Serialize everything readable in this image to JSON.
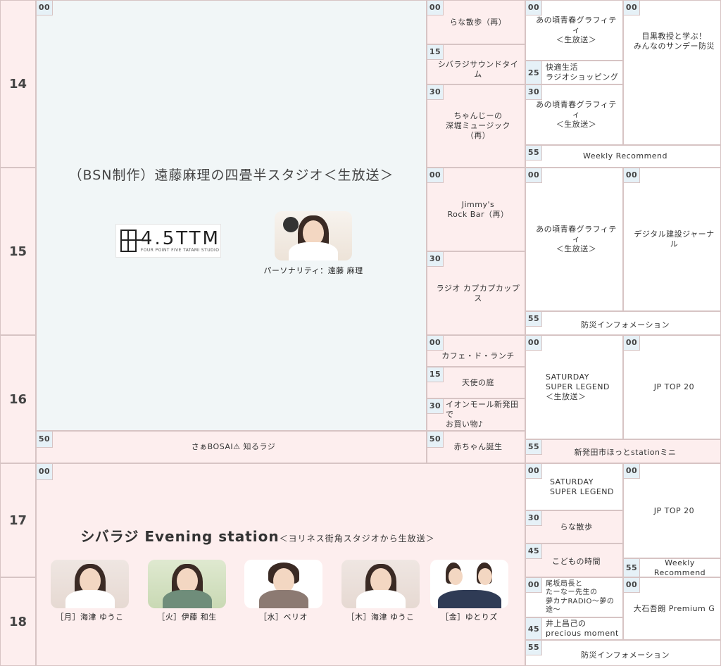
{
  "hours": [
    "14",
    "15",
    "16",
    "17",
    "18"
  ],
  "slots": [
    {
      "name": "slot-4-5ttm",
      "time": "00",
      "title": "",
      "bg": "blue"
    },
    {
      "name": "slot-saa-bosai",
      "time": "50",
      "title": "さぁBOSAI⚠ 知るラジ",
      "bg": "pink"
    },
    {
      "name": "slot-evening-station",
      "time": "00",
      "title": "",
      "bg": "pink"
    },
    {
      "name": "slot-rana-sanpo-re",
      "time": "00",
      "title": "らな散歩（再）",
      "bg": "pink"
    },
    {
      "name": "slot-shibaraji-sound-time",
      "time": "15",
      "title": "シバラジサウンドタイム",
      "bg": "pink"
    },
    {
      "name": "slot-chanji-music",
      "time": "30",
      "title": "ちゃんじーの\n深堀ミュージック\n（再）",
      "bg": "pink"
    },
    {
      "name": "slot-jimmys-rock-bar",
      "time": "00",
      "title": "Jimmy's\nRock Bar（再）",
      "bg": "pink"
    },
    {
      "name": "slot-radio-kapukapu",
      "time": "30",
      "title": "ラジオ カプカプカップス",
      "bg": "pink"
    },
    {
      "name": "slot-cafe-de-lunch",
      "time": "00",
      "title": "カフェ・ド・ランチ",
      "bg": "pink"
    },
    {
      "name": "slot-tenshi-no-niwa",
      "time": "15",
      "title": "天使の庭",
      "bg": "pink"
    },
    {
      "name": "slot-aeon-mall",
      "time": "30",
      "title": "イオンモール新発田で\nお買い物♪",
      "bg": "pink"
    },
    {
      "name": "slot-akachan-tanjo",
      "time": "50",
      "title": "赤ちゃん誕生",
      "bg": "pink"
    },
    {
      "name": "slot-anokoro-1",
      "time": "00",
      "title": "あの頃青春グラフィティ\n＜生放送＞",
      "bg": "white"
    },
    {
      "name": "slot-kaiteki-seikatsu",
      "time": "25",
      "title": "快適生活\nラジオショッピング",
      "bg": "white"
    },
    {
      "name": "slot-anokoro-2",
      "time": "30",
      "title": "あの頃青春グラフィティ\n＜生放送＞",
      "bg": "white"
    },
    {
      "name": "slot-weekly-recommend-1",
      "time": "55",
      "title": "Weekly Recommend",
      "bg": "white"
    },
    {
      "name": "slot-anokoro-3",
      "time": "00",
      "title": "あの頃青春グラフィティ\n＜生放送＞",
      "bg": "white"
    },
    {
      "name": "slot-bosai-info-1",
      "time": "55",
      "title": "防災インフォメーション",
      "bg": "white"
    },
    {
      "name": "slot-saturday-legend-1",
      "time": "00",
      "title": "SATURDAY\nSUPER LEGEND\n＜生放送＞",
      "bg": "white"
    },
    {
      "name": "slot-shibata-hotto",
      "time": "55",
      "title": "新発田市ほっとstationミニ",
      "bg": "pink"
    },
    {
      "name": "slot-saturday-legend-2",
      "time": "00",
      "title": "SATURDAY\nSUPER LEGEND",
      "bg": "white"
    },
    {
      "name": "slot-rana-sanpo",
      "time": "30",
      "title": "らな散歩",
      "bg": "pink"
    },
    {
      "name": "slot-kodomo-jikan",
      "time": "45",
      "title": "こどもの時間",
      "bg": "pink"
    },
    {
      "name": "slot-osaka-yume",
      "time": "00",
      "title": "尾坂局長と\nたーなー先生の\n夢カナRADIO〜夢の途〜",
      "bg": "white"
    },
    {
      "name": "slot-inoue-precious",
      "time": "45",
      "title": "井上昌己の\nprecious moment",
      "bg": "white"
    },
    {
      "name": "slot-bosai-info-2",
      "time": "55",
      "title": "防災インフォメーション",
      "bg": "white"
    },
    {
      "name": "slot-meguro-bosai",
      "time": "00",
      "title": "目黒教授と学ぶ！\nみんなのサンデー防災",
      "bg": "white"
    },
    {
      "name": "slot-digital-kensetsu",
      "time": "00",
      "title": "デジタル建設ジャーナル",
      "bg": "white"
    },
    {
      "name": "slot-jp-top20-1",
      "time": "00",
      "title": "JP TOP 20",
      "bg": "white"
    },
    {
      "name": "slot-jp-top20-2",
      "time": "00",
      "title": "JP TOP 20",
      "bg": "white"
    },
    {
      "name": "slot-weekly-recommend-2",
      "time": "55",
      "title": "Weekly Recommend",
      "bg": "white"
    },
    {
      "name": "slot-oishi-premium",
      "time": "00",
      "title": "大石吾朗 Premium G",
      "bg": "white"
    }
  ],
  "studio": {
    "title": "（BSN制作）遠藤麻理の四畳半スタジオ＜生放送＞",
    "logo_main": "4.5TTM",
    "logo_sub": "FOUR POINT FIVE TATAMI STUDIO",
    "personality": "パーソナリティ：遠藤 麻理"
  },
  "evening": {
    "title": "シバラジ Evening station",
    "subtitle": "＜ヨリネス街角スタジオから生放送＞",
    "hosts": [
      {
        "caption": "［月］海津 ゆうこ"
      },
      {
        "caption": "［火］伊藤 和生"
      },
      {
        "caption": "［水］ベリオ"
      },
      {
        "caption": "［木］海津 ゆうこ"
      },
      {
        "caption": "［金］ゆとりズ"
      }
    ]
  }
}
